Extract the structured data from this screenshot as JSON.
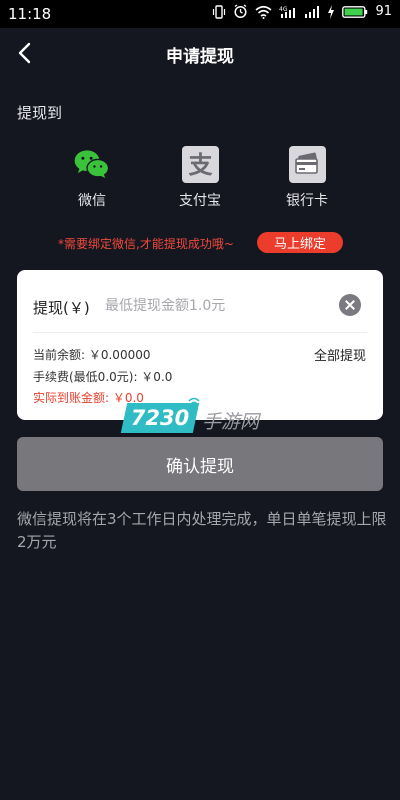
{
  "status_bar": {
    "time": "11:18",
    "battery": "91",
    "network": "4G"
  },
  "header": {
    "title": "申请提现"
  },
  "withdraw_to": {
    "label": "提现到",
    "methods": [
      {
        "label": "微信",
        "icon": "wechat-icon",
        "color": "#3bc23b"
      },
      {
        "label": "支付宝",
        "icon": "alipay-icon",
        "color": "#d8d8dc"
      },
      {
        "label": "银行卡",
        "icon": "bank-card-icon",
        "color": "#d8d8dc"
      }
    ]
  },
  "bind_notice": {
    "text": "*需要绑定微信,才能提现成功哦~",
    "button": "马上绑定"
  },
  "form": {
    "amount_label": "提现(￥)",
    "amount_placeholder": "最低提现金额1.0元",
    "amount_value": "",
    "balance": "当前余额: ￥0.00000",
    "withdraw_all": "全部提现",
    "fee": "手续费(最低0.0元): ￥0.0",
    "actual": "实际到账金额: ￥0.0"
  },
  "confirm_button": "确认提现",
  "footnote": "微信提现将在3个工作日内处理完成，单日单笔提现上限2万元",
  "watermark": {
    "number": "7230",
    "text": "手游网"
  },
  "colors": {
    "background": "#141620",
    "accent_red": "#ec3d2c",
    "disabled_button": "#77777c",
    "wechat_green": "#3bc23b"
  }
}
